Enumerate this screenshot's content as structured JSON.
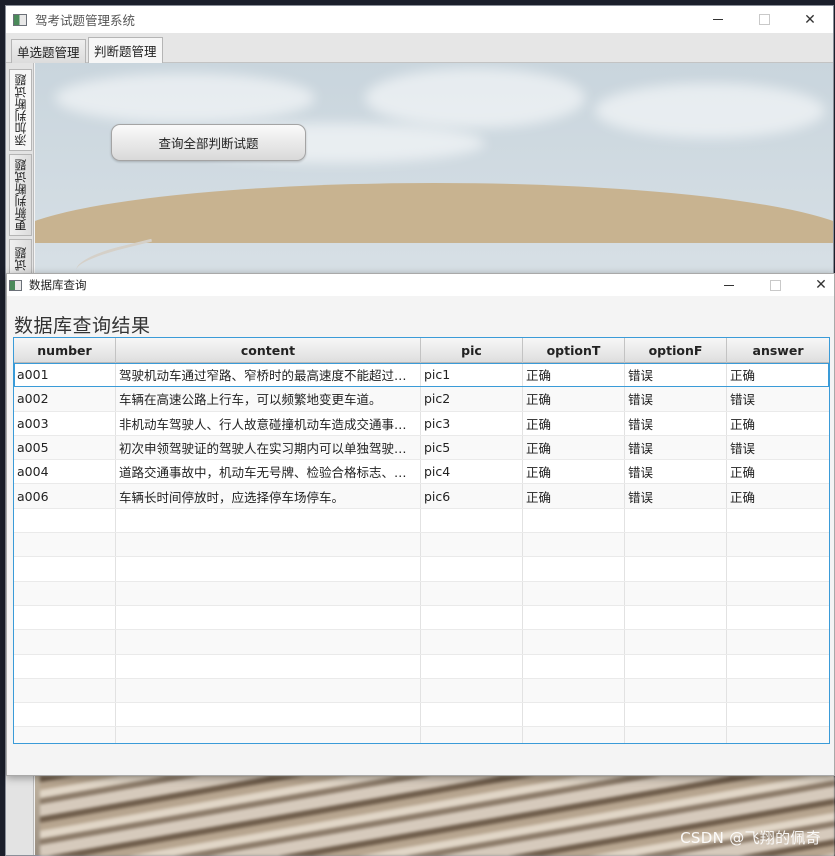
{
  "main_window": {
    "title": "驾考试题管理系统",
    "top_tabs": [
      "单选题管理",
      "判断题管理"
    ],
    "selected_top_tab": 1,
    "side_tabs": [
      "添加判断试题",
      "更新判断试题",
      "试题"
    ],
    "query_all_button": "查询全部判断试题"
  },
  "dialog": {
    "title": "数据库查询",
    "heading": "数据库查询结果",
    "table": {
      "columns": [
        "number",
        "content",
        "pic",
        "optionT",
        "optionF",
        "answer"
      ],
      "rows": [
        [
          "a001",
          "驾驶机动车通过窄路、窄桥时的最高速度不能超过每...",
          "pic1",
          "正确",
          "错误",
          "正确"
        ],
        [
          "a002",
          "车辆在高速公路上行车，可以频繁地变更车道。",
          "pic2",
          "正确",
          "错误",
          "错误"
        ],
        [
          "a003",
          "非机动车驾驶人、行人故意碰撞机动车造成交通事故...",
          "pic3",
          "正确",
          "错误",
          "正确"
        ],
        [
          "a005",
          "初次申领驾驶证的驾驶人在实习期内可以单独驾驶机...",
          "pic5",
          "正确",
          "错误",
          "错误"
        ],
        [
          "a004",
          "道路交通事故中，机动车无号牌、检验合格标志、保...",
          "pic4",
          "正确",
          "错误",
          "正确"
        ],
        [
          "a006",
          "车辆长时间停放时，应选择停车场停车。",
          "pic6",
          "正确",
          "错误",
          "正确"
        ]
      ],
      "empty_rows": 10
    }
  },
  "watermark": "CSDN @飞翔的佩奇",
  "colors": {
    "selection_border": "#3a9bd8"
  },
  "icons": [
    "app-icon",
    "minimize-icon",
    "maximize-icon",
    "close-icon"
  ]
}
